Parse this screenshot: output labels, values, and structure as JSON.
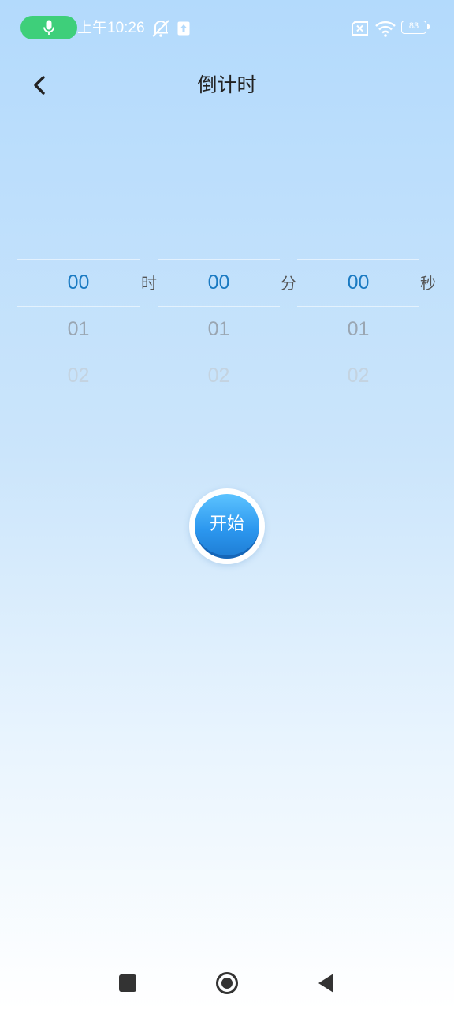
{
  "status_bar": {
    "time": "上午10:26",
    "battery": "83",
    "icons": [
      "microphone-icon",
      "mute-bell-icon",
      "upload-icon",
      "sim-error-icon",
      "wifi-icon",
      "battery-icon"
    ],
    "mic_color": "#3ecf7a"
  },
  "header": {
    "title": "倒计时",
    "back_icon": "back-chevron-icon"
  },
  "pickers": [
    {
      "unit": "时",
      "selected": "00",
      "next": [
        "01",
        "02"
      ]
    },
    {
      "unit": "分",
      "selected": "00",
      "next": [
        "01",
        "02"
      ]
    },
    {
      "unit": "秒",
      "selected": "00",
      "next": [
        "01",
        "02"
      ]
    }
  ],
  "start_button": {
    "label": "开始",
    "color": "#2b96ee"
  },
  "nav_bar": {
    "icons": [
      "recent-apps-icon",
      "home-icon",
      "back-triangle-icon"
    ]
  }
}
